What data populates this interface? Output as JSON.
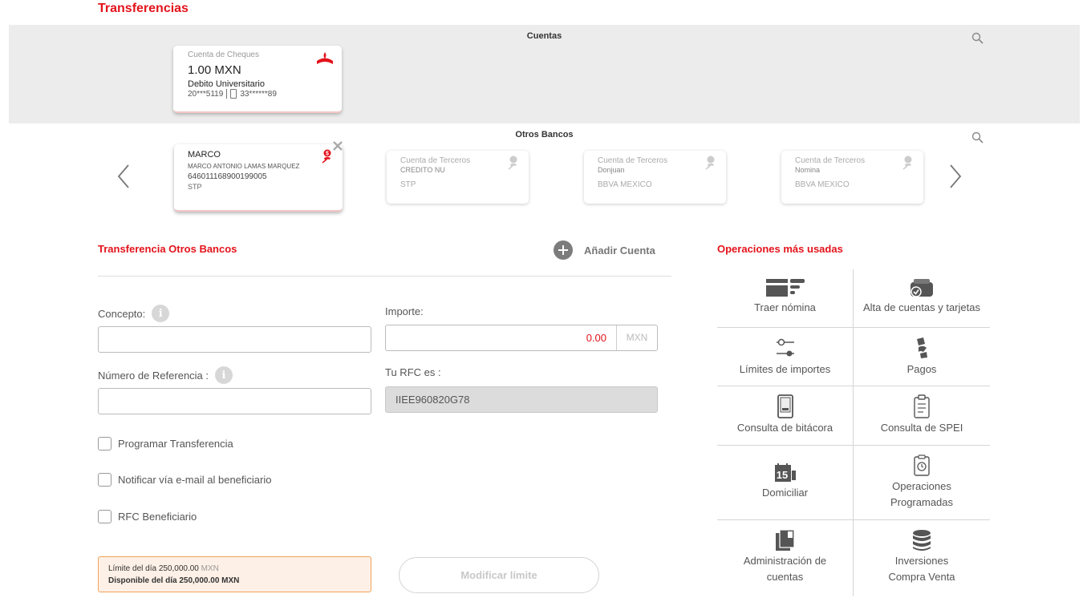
{
  "page": {
    "title": "Transferencias"
  },
  "cuentas": {
    "label": "Cuentas",
    "card": {
      "type": "Cuenta de Cheques",
      "amount": "1.00 MXN",
      "name": "Debito Universitario",
      "account_number": "20***5119",
      "phone_number": "33******89"
    }
  },
  "otros_bancos": {
    "label": "Otros Bancos",
    "selected": {
      "name": "MARCO",
      "full_name": "MARCO ANTONIO LAMAS MARQUEZ",
      "clabe": "646011168900199005",
      "bank": "STP"
    },
    "others": [
      {
        "type": "Cuenta de Terceros",
        "alias": "CREDITO NU",
        "bank": "STP"
      },
      {
        "type": "Cuenta de Terceros",
        "alias": "Donjuan",
        "bank": "BBVA MEXICO"
      },
      {
        "type": "Cuenta de Terceros",
        "alias": "Nomina",
        "bank": "BBVA MEXICO"
      }
    ]
  },
  "form": {
    "title": "Transferencia Otros Bancos",
    "add_account": "Añadir Cuenta",
    "concepto_label": "Concepto:",
    "concepto_value": "",
    "referencia_label": "Número de Referencia :",
    "referencia_value": "",
    "importe_label": "Importe:",
    "importe_value": "0.00",
    "importe_currency": "MXN",
    "rfc_label": "Tu RFC es :",
    "rfc_value": "IIEE960820G78",
    "info_glyph": "i",
    "checks": [
      {
        "label": "Programar Transferencia",
        "checked": false
      },
      {
        "label": "Notificar vía e-mail al beneficiario",
        "checked": false
      },
      {
        "label": "RFC Beneficiario",
        "checked": false
      }
    ],
    "limit_line1": "Límite del día 250,000.00",
    "limit_line1_currency": "MXN",
    "limit_line2": "Disponible del día 250,000.00 MXN",
    "modify_button": "Modificar límite"
  },
  "operaciones": {
    "title": "Operaciones más usadas",
    "items": [
      {
        "label": "Traer nómina",
        "icon": "payroll-icon"
      },
      {
        "label": "Alta de cuentas y tarjetas",
        "icon": "wallet-icon"
      },
      {
        "label": "Límites de importes",
        "icon": "sliders-icon"
      },
      {
        "label": "Pagos",
        "icon": "payments-icon"
      },
      {
        "label": "Consulta de bitácora",
        "icon": "phone-log-icon"
      },
      {
        "label": "Consulta de SPEI",
        "icon": "clipboard-icon"
      },
      {
        "label": "Domiciliar",
        "icon": "calendar-icon"
      },
      {
        "label": "Operaciones Programadas",
        "icon": "scheduled-icon"
      },
      {
        "label": "Administración de cuentas",
        "icon": "account-admin-icon"
      },
      {
        "label": "Inversiones Compra Venta",
        "icon": "coins-icon"
      }
    ],
    "calendar_day": "15"
  },
  "colors": {
    "brand_red": "#e3131b",
    "band_gray": "#ececec",
    "icon_dark": "#555555"
  }
}
